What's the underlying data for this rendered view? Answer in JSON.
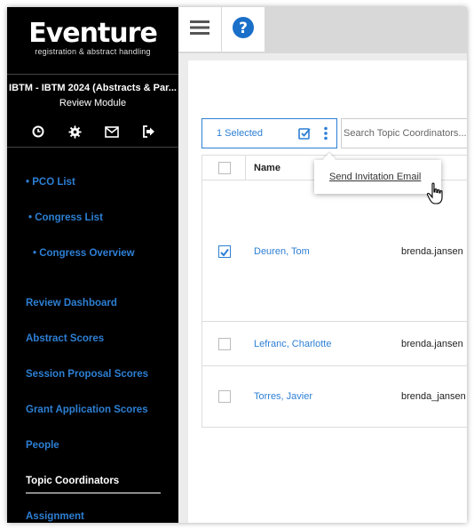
{
  "brand": {
    "name": "Eventure",
    "tagline": "registration & abstract handling"
  },
  "event": {
    "title": "IBTM - IBTM 2024 (Abstracts & Par...",
    "module": "Review Module"
  },
  "sidebar_icons": [
    "clock-icon",
    "gear-icon",
    "envelope-icon",
    "logout-icon"
  ],
  "nav": {
    "pco_list": "• PCO List",
    "congress_list": "• Congress List",
    "congress_overview": "• Congress Overview",
    "review_dashboard": "Review Dashboard",
    "abstract_scores": "Abstract Scores",
    "session_proposal_scores": "Session Proposal Scores",
    "grant_application_scores": "Grant Application Scores",
    "people": "People",
    "topic_coordinators": "Topic Coordinators",
    "assignment": "Assignment"
  },
  "toolbar": {
    "selected_label": "1 Selected",
    "search_placeholder": "Search Topic Coordinators..."
  },
  "table": {
    "name_header": "Name",
    "rows": [
      {
        "name": "Deuren, Tom",
        "email": "brenda.jansen",
        "checked": true
      },
      {
        "name": "Lefranc, Charlotte",
        "email": "brenda.jansen",
        "checked": false
      },
      {
        "name": "Torres, Javier",
        "email": "brenda_jansen",
        "checked": false
      }
    ]
  },
  "dropdown": {
    "item": "Send Invitation Email"
  },
  "colors": {
    "accent": "#2d7fd4",
    "sidebar_bg": "#000000",
    "content_bg": "#ececec"
  }
}
